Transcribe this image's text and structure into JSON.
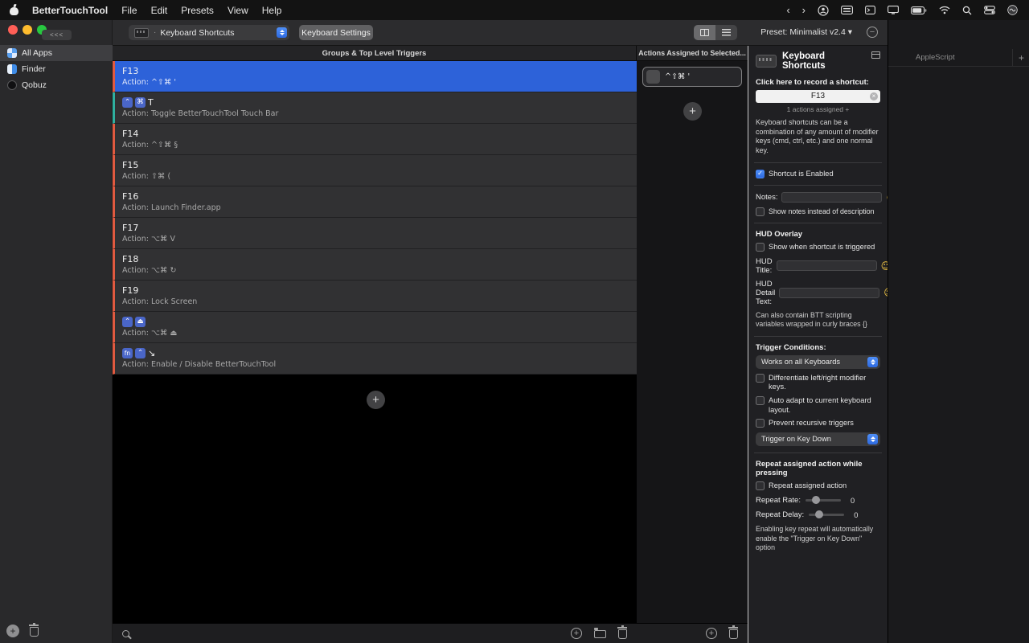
{
  "menubar": {
    "app_name": "BetterTouchTool",
    "menus": [
      "File",
      "Edit",
      "Presets",
      "View",
      "Help"
    ],
    "status_icons": [
      "chevron-left",
      "chevron-right",
      "user",
      "keyboard",
      "terminal",
      "display",
      "battery",
      "wifi",
      "search",
      "control-center",
      "siri"
    ],
    "chevron_left": "‹",
    "chevron_right": "›"
  },
  "sidebar": {
    "collapse_label": "<<<",
    "items": [
      {
        "label": "All Apps",
        "selected": true
      },
      {
        "label": "Finder",
        "selected": false
      },
      {
        "label": "Qobuz",
        "selected": false
      }
    ]
  },
  "toolbar": {
    "trigger_popup_label": "Keyboard Shortcuts",
    "popup_separator": "·",
    "settings_button": "Keyboard Settings",
    "preset_label": "Preset: Minimalist v2.4 ▾",
    "remove_preset_glyph": "−"
  },
  "triggers": {
    "header": "Groups & Top Level Triggers",
    "rows": [
      {
        "title": "F13",
        "action": "Action: ^⇧⌘ '",
        "accent": "#e05a40",
        "selected": true
      },
      {
        "badges": [
          "⌃",
          "⌘"
        ],
        "title": "T",
        "action": "Action: Toggle BetterTouchTool Touch Bar",
        "accent": "#2fb0a0",
        "selected": false
      },
      {
        "title": "F14",
        "action": "Action: ^⇧⌘ §",
        "accent": "#e05a40",
        "selected": false
      },
      {
        "title": "F15",
        "action": "Action: ⇧⌘ (",
        "accent": "#e05a40",
        "selected": false
      },
      {
        "title": "F16",
        "action": "Action: Launch Finder.app",
        "accent": "#e05a40",
        "selected": false
      },
      {
        "title": "F17",
        "action": "Action: ⌥⌘ V",
        "accent": "#e05a40",
        "selected": false
      },
      {
        "title": "F18",
        "action": "Action: ⌥⌘ ↻",
        "accent": "#e05a40",
        "selected": false
      },
      {
        "title": "F19",
        "action": "Action: Lock Screen",
        "accent": "#e05a40",
        "selected": false
      },
      {
        "badges": [
          "⌃",
          "⏏"
        ],
        "title": "",
        "action": "Action: ⌥⌘ ⏏",
        "accent": "#e05a40",
        "selected": false
      },
      {
        "badges": [
          "fn",
          "⌃"
        ],
        "title": "↘",
        "action": "Action: Enable / Disable BetterTouchTool",
        "accent": "#e05a40",
        "selected": false
      }
    ]
  },
  "actions_column": {
    "header": "Actions Assigned to Selected...",
    "items": [
      {
        "label": "^⇧⌘ '"
      }
    ]
  },
  "inspector": {
    "title": "Keyboard Shortcuts",
    "record_label": "Click here to record a shortcut:",
    "shortcut_value": "F13",
    "assigned_label": "1 actions assigned +",
    "description": "Keyboard shortcuts can be a combination of any amount of modifier keys (cmd, ctrl, etc.) and one normal key.",
    "enabled_label": "Shortcut is Enabled",
    "enabled_checked": true,
    "notes_label": "Notes:",
    "show_notes_label": "Show notes instead of description",
    "hud_overlay_title": "HUD Overlay",
    "hud_show_label": "Show when shortcut is triggered",
    "hud_title_label": "HUD Title:",
    "hud_detail_label": "HUD Detail Text:",
    "hud_hint": "Can also contain BTT scripting variables wrapped in curly braces {}",
    "trigger_conditions_title": "Trigger Conditions:",
    "keyboards_dropdown": "Works on all Keyboards",
    "differentiate_label": "Differentiate left/right modifier keys.",
    "auto_adapt_label": "Auto adapt to current keyboard layout.",
    "prevent_recursive_label": "Prevent recursive triggers",
    "trigger_dropdown": "Trigger on Key Down",
    "repeat_title": "Repeat assigned action while pressing",
    "repeat_action_label": "Repeat assigned action",
    "repeat_rate_label": "Repeat Rate:",
    "repeat_rate_value": "0",
    "repeat_delay_label": "Repeat Delay:",
    "repeat_delay_value": "0",
    "repeat_hint": "Enabling key repeat will automatically enable the \"Trigger on Key Down\" option"
  },
  "right_panel": {
    "tab_label": "AppleScript",
    "add_label": "+"
  },
  "icons": {
    "check": "✓",
    "clear": "×",
    "smiley": "☺",
    "plus": "+",
    "minus": "−"
  },
  "colors": {
    "selection_blue": "#2d62d9",
    "accent_orange": "#e05a40",
    "accent_teal": "#2fb0a0",
    "checkbox_blue": "#2e6ae0"
  }
}
